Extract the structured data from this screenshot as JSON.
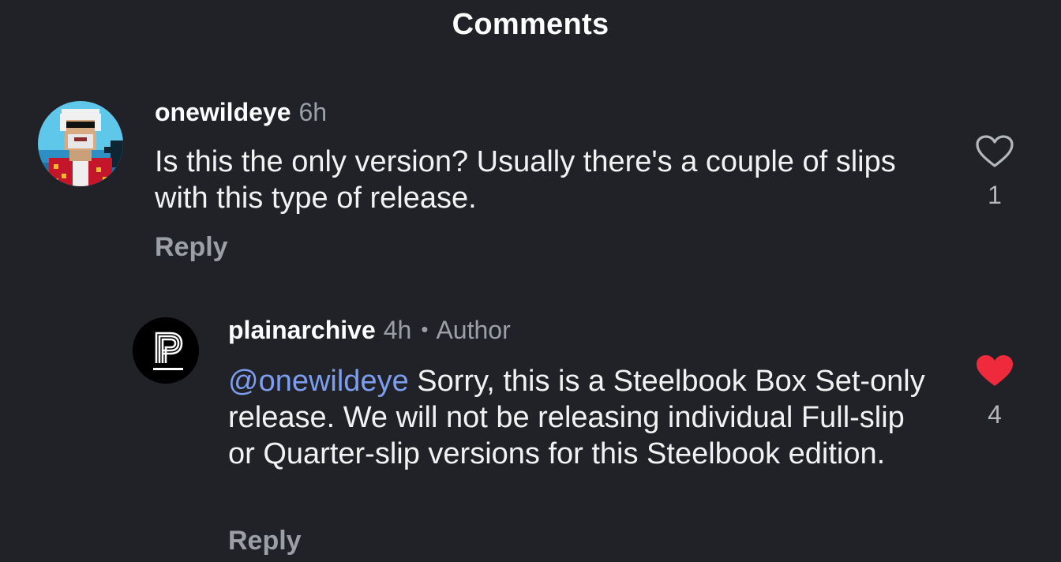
{
  "header": {
    "title": "Comments"
  },
  "colors": {
    "background": "#202227",
    "mention": "#7d9ef0",
    "liked_heart": "#ee2a3c",
    "muted_text": "#9aa0a6"
  },
  "comments": [
    {
      "username": "onewildeye",
      "time": "6h",
      "avatar_icon": "pixel-art-avatar",
      "text": "Is this the only version? Usually there's a couple of slips with this type of release.",
      "reply_label": "Reply",
      "like_icon": "heart-outline-icon",
      "like_count": "1",
      "liked": false
    },
    {
      "username": "plainarchive",
      "time": "4h",
      "separator": "•",
      "author_tag": "Author",
      "avatar_icon": "plainarchive-logo",
      "mention": "@onewildeye",
      "text": " Sorry, this is a Steelbook Box Set-only release. We will not be releasing individual Full-slip or Quarter-slip versions for this Steelbook edition.",
      "reply_label": "Reply",
      "like_icon": "heart-filled-icon",
      "like_count": "4",
      "liked": true
    }
  ]
}
